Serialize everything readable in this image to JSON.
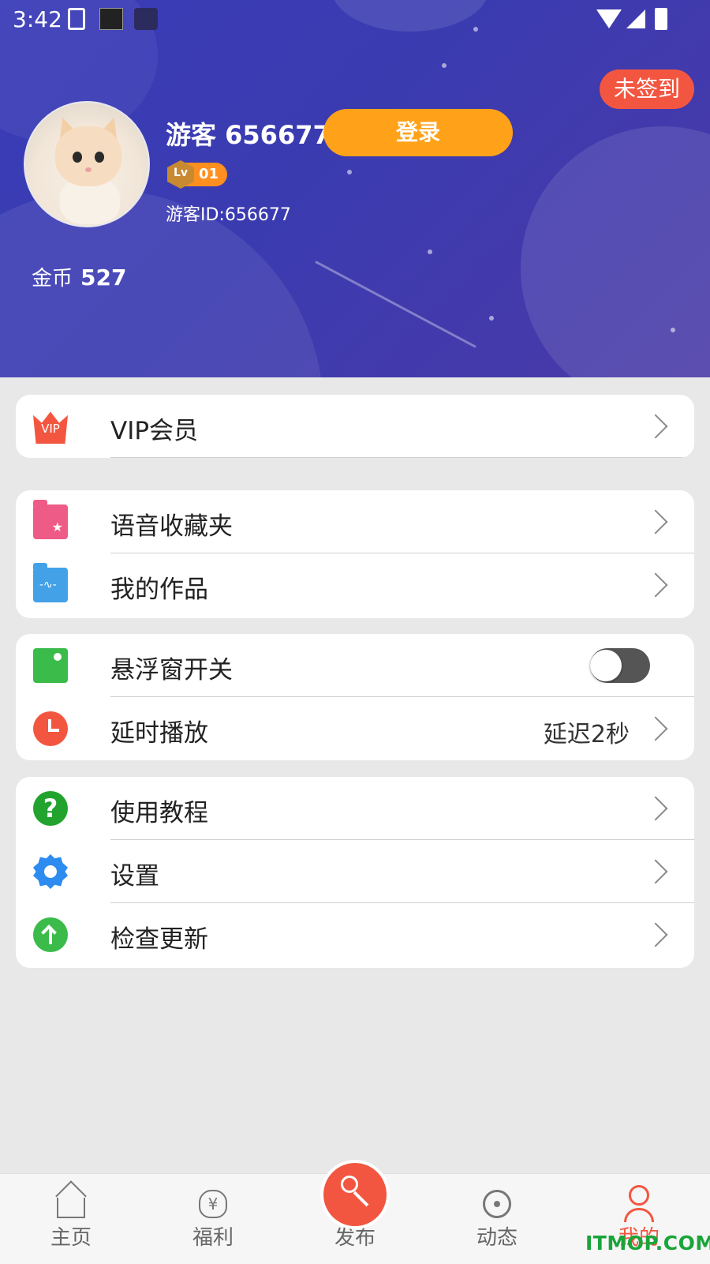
{
  "status_bar": {
    "time": "3:42"
  },
  "profile": {
    "checkin_label": "未签到",
    "username": "游客 656677",
    "login_label": "登录",
    "level_icon": "Lv",
    "level_value": "01",
    "guest_id": "游客ID:656677",
    "coins_label": "金币",
    "coins_value": "527"
  },
  "menu": {
    "vip": {
      "icon_text": "VIP",
      "label": "VIP会员"
    },
    "favorites": {
      "label": "语音收藏夹"
    },
    "works": {
      "label": "我的作品"
    },
    "float_window": {
      "label": "悬浮窗开关",
      "enabled": false
    },
    "delay": {
      "label": "延时播放",
      "value": "延迟2秒"
    },
    "tutorial": {
      "label": "使用教程"
    },
    "settings": {
      "label": "设置"
    },
    "update": {
      "label": "检查更新"
    }
  },
  "bottom_nav": {
    "home": "主页",
    "welfare": "福利",
    "welfare_icon": "¥",
    "publish": "发布",
    "feed": "动态",
    "mine": "我的"
  },
  "watermark": "ITMOP.COM",
  "colors": {
    "accent": "#f35640",
    "header": "#3a3db8",
    "login": "#ffa21a"
  }
}
